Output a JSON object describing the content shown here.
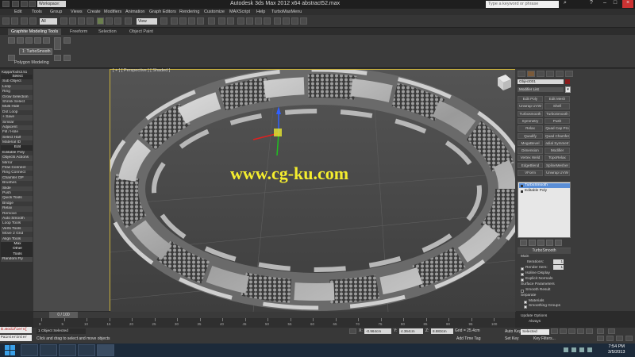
{
  "window": {
    "title": "Autodesk 3ds Max  2012 x64      abstract52.max",
    "workspace": "Workspace: Default",
    "search_placeholder": "Type a keyword or phrase"
  },
  "menu": [
    "Edit",
    "Tools",
    "Group",
    "Views",
    "Create",
    "Modifiers",
    "Animation",
    "Graph Editors",
    "Rendering",
    "Customize",
    "MAXScript",
    "Help",
    "TurboMaxMenu"
  ],
  "toolbar": {
    "selection_filter": "All",
    "view": "View"
  },
  "ribbon": {
    "tabs": [
      "Graphite Modeling Tools",
      "Freeform",
      "Selection",
      "Object Paint"
    ],
    "active_tab": "Graphite Modeling Tools",
    "stack_label": "1: TurboSmooth",
    "panel_label": "Polygon Modeling"
  },
  "left_panel": {
    "title": "KappaTools3.51",
    "items": [
      "Select",
      "Sub Object",
      "Loop",
      "Ring",
      "Grow Selection",
      "Shrink Select",
      "Multi Hide",
      "Dot Loop",
      "+ Save",
      "Similar",
      "Adjacent",
      "Fill / Hole",
      "Select Half",
      "Material ID",
      "Edit",
      "Editable Poly",
      "Objects Actions",
      "Mirror",
      "Flow Connect",
      "Ring Connect",
      "Chamfer OP",
      "Brushes",
      "Slide",
      "Push",
      "Quick Tools",
      "Bridge",
      "Relax",
      "Remove",
      "Auto Smooth",
      "Loop Tools",
      "Verts Tools",
      "Move 2 Grid",
      "Align Tools",
      "Max",
      "Other",
      "Tools",
      "Random Fly"
    ]
  },
  "viewport": {
    "label": "[ + ] [ Perspective ] [ Shaded ]",
    "watermark": "www.cg-ku.com"
  },
  "command_panel": {
    "object_name": "Object001",
    "modifier_list": "Modifier List",
    "modifier_buttons": [
      "Edit Poly",
      "Edit Mesh",
      "Unwrap UVW",
      "Shell",
      "Turbosmooth",
      "TurboSmooth",
      "Symmetry",
      "Push",
      "Relax",
      "Quad Cap Pro",
      "Quadify",
      "Quad Chamfer",
      "MegaBevel",
      "adial Symmetr",
      "Dimension",
      "Modifier",
      "Vertex Weld",
      "TopoRelax",
      "EdgeBlend",
      "SplineMesher",
      "VForm",
      "Unwrap UVW"
    ],
    "stack": [
      "TurboSmooth",
      "Editable Poly"
    ],
    "stack_selected": 0,
    "rollout_title": "TurboSmooth",
    "main_label": "Main",
    "iterations_label": "Iterations:",
    "iterations_value": "1",
    "render_iters_label": "Render Iters:",
    "render_iters_value": "1",
    "isoline_label": "Isoline Display",
    "explicit_normals_label": "Explicit Normals",
    "surface_params_label": "Surface Parameters",
    "smooth_result_label": "Smooth Result",
    "separate_label": "Separate",
    "materials_label": "Materials",
    "smoothing_groups_label": "Smoothing Groups",
    "update_options_label": "Update Options",
    "always_label": "Always"
  },
  "timeline": {
    "frame_display": "0 / 100",
    "ticks": [
      "0",
      "5",
      "10",
      "15",
      "20",
      "25",
      "30",
      "35",
      "40",
      "45",
      "50",
      "55",
      "60",
      "65",
      "70",
      "75",
      "80",
      "85",
      "90",
      "95",
      "100"
    ]
  },
  "status": {
    "maxscript_line": "$.modifiers[",
    "listener_line": "PainterInter",
    "selected_count": "1 Object Selected",
    "prompt": "Click and drag to select and move objects",
    "x_label": "X:",
    "x_value": "-0.964cm",
    "y_label": "Y:",
    "y_value": "4.364cm",
    "z_label": "Z:",
    "z_value": "8.883cm",
    "grid": "Grid = 25.4cm",
    "add_time_tag": "Add Time Tag",
    "auto_key": "Auto Key",
    "set_key": "Set Key",
    "selected_dropdown": "Selected",
    "key_filters": "Key Filters..."
  },
  "taskbar": {
    "time": "7:54 PM",
    "date": "3/5/2013"
  }
}
